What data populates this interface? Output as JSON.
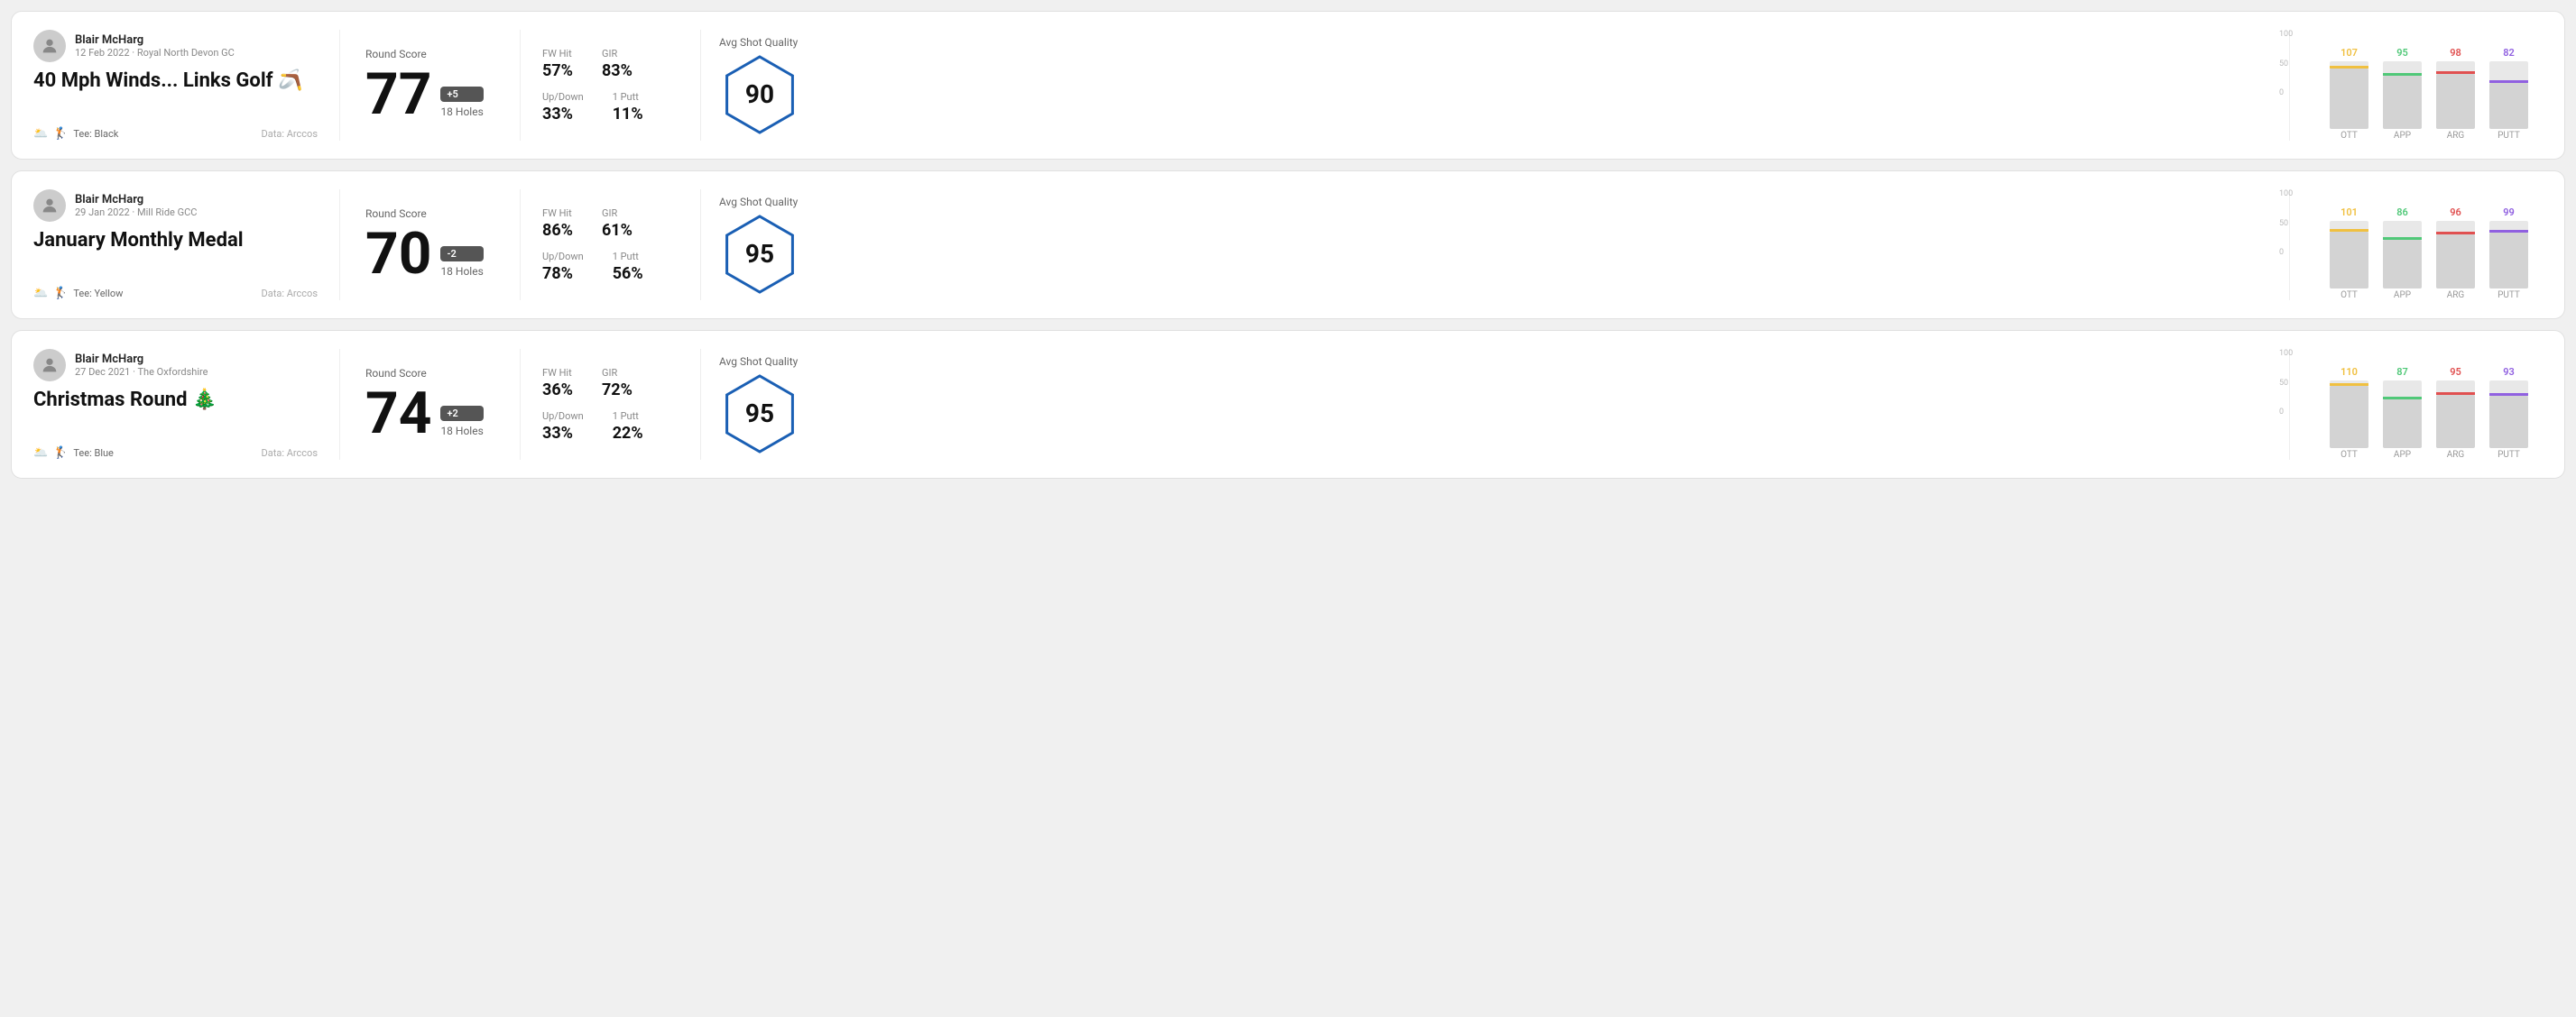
{
  "rounds": [
    {
      "id": "round-1",
      "user": {
        "name": "Blair McHarg",
        "meta": "12 Feb 2022 · Royal North Devon GC"
      },
      "title": "40 Mph Winds... Links Golf 🪃",
      "tee": "Black",
      "data_source": "Data: Arccos",
      "score": {
        "label": "Round Score",
        "number": "77",
        "badge": "+5",
        "holes": "18 Holes"
      },
      "stats": {
        "fw_hit_label": "FW Hit",
        "fw_hit_value": "57%",
        "gir_label": "GIR",
        "gir_value": "83%",
        "updown_label": "Up/Down",
        "updown_value": "33%",
        "oneputt_label": "1 Putt",
        "oneputt_value": "11%"
      },
      "quality": {
        "label": "Avg Shot Quality",
        "score": "90"
      },
      "chart": {
        "bars": [
          {
            "label": "OTT",
            "value": 107,
            "color": "#f0c040",
            "max": 120
          },
          {
            "label": "APP",
            "value": 95,
            "color": "#50c878",
            "max": 120
          },
          {
            "label": "ARG",
            "value": 98,
            "color": "#e05050",
            "max": 120
          },
          {
            "label": "PUTT",
            "value": 82,
            "color": "#9060e0",
            "max": 120
          }
        ]
      }
    },
    {
      "id": "round-2",
      "user": {
        "name": "Blair McHarg",
        "meta": "29 Jan 2022 · Mill Ride GCC"
      },
      "title": "January Monthly Medal",
      "tee": "Yellow",
      "data_source": "Data: Arccos",
      "score": {
        "label": "Round Score",
        "number": "70",
        "badge": "-2",
        "holes": "18 Holes"
      },
      "stats": {
        "fw_hit_label": "FW Hit",
        "fw_hit_value": "86%",
        "gir_label": "GIR",
        "gir_value": "61%",
        "updown_label": "Up/Down",
        "updown_value": "78%",
        "oneputt_label": "1 Putt",
        "oneputt_value": "56%"
      },
      "quality": {
        "label": "Avg Shot Quality",
        "score": "95"
      },
      "chart": {
        "bars": [
          {
            "label": "OTT",
            "value": 101,
            "color": "#f0c040",
            "max": 120
          },
          {
            "label": "APP",
            "value": 86,
            "color": "#50c878",
            "max": 120
          },
          {
            "label": "ARG",
            "value": 96,
            "color": "#e05050",
            "max": 120
          },
          {
            "label": "PUTT",
            "value": 99,
            "color": "#9060e0",
            "max": 120
          }
        ]
      }
    },
    {
      "id": "round-3",
      "user": {
        "name": "Blair McHarg",
        "meta": "27 Dec 2021 · The Oxfordshire"
      },
      "title": "Christmas Round 🎄",
      "tee": "Blue",
      "data_source": "Data: Arccos",
      "score": {
        "label": "Round Score",
        "number": "74",
        "badge": "+2",
        "holes": "18 Holes"
      },
      "stats": {
        "fw_hit_label": "FW Hit",
        "fw_hit_value": "36%",
        "gir_label": "GIR",
        "gir_value": "72%",
        "updown_label": "Up/Down",
        "updown_value": "33%",
        "oneputt_label": "1 Putt",
        "oneputt_value": "22%"
      },
      "quality": {
        "label": "Avg Shot Quality",
        "score": "95"
      },
      "chart": {
        "bars": [
          {
            "label": "OTT",
            "value": 110,
            "color": "#f0c040",
            "max": 120
          },
          {
            "label": "APP",
            "value": 87,
            "color": "#50c878",
            "max": 120
          },
          {
            "label": "ARG",
            "value": 95,
            "color": "#e05050",
            "max": 120
          },
          {
            "label": "PUTT",
            "value": 93,
            "color": "#9060e0",
            "max": 120
          }
        ]
      }
    }
  ]
}
